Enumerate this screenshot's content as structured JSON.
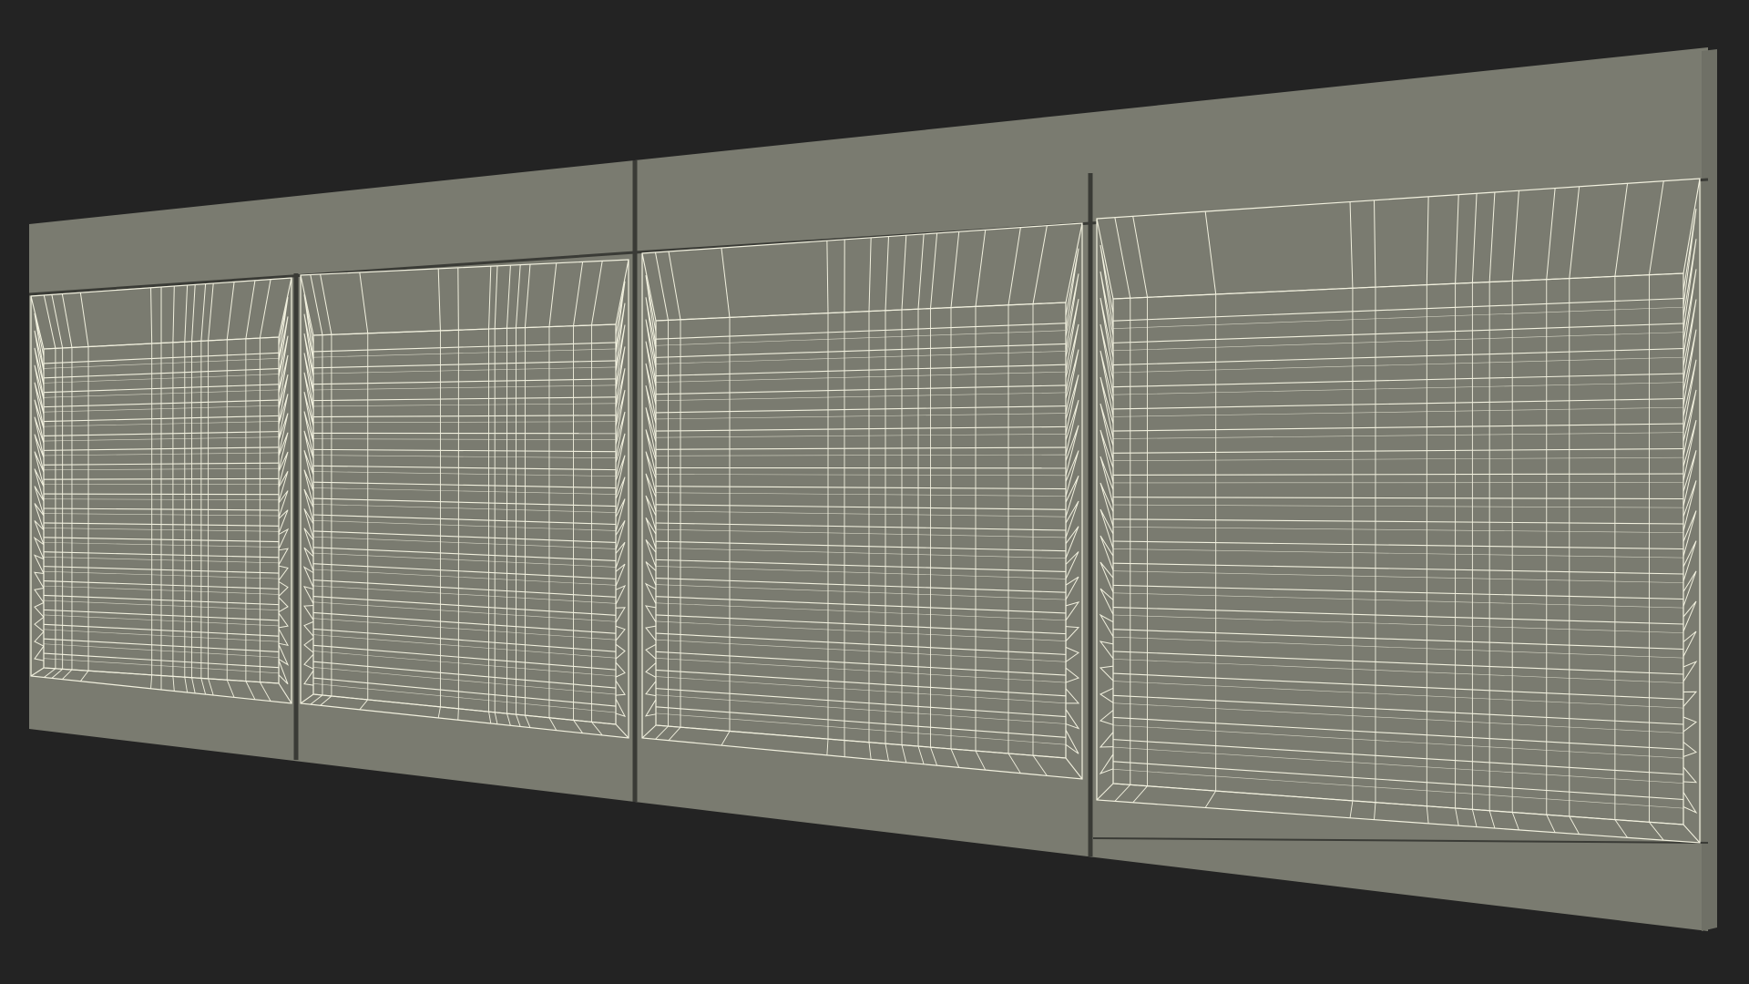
{
  "scene": {
    "background_color": "#232323",
    "surface_color": "#7a7b70",
    "surface_shade_color": "#6f7066",
    "wire_color": "#f2f1df",
    "seam_color": "#3a3b36",
    "panel_count": 4,
    "slat_count": 22
  }
}
